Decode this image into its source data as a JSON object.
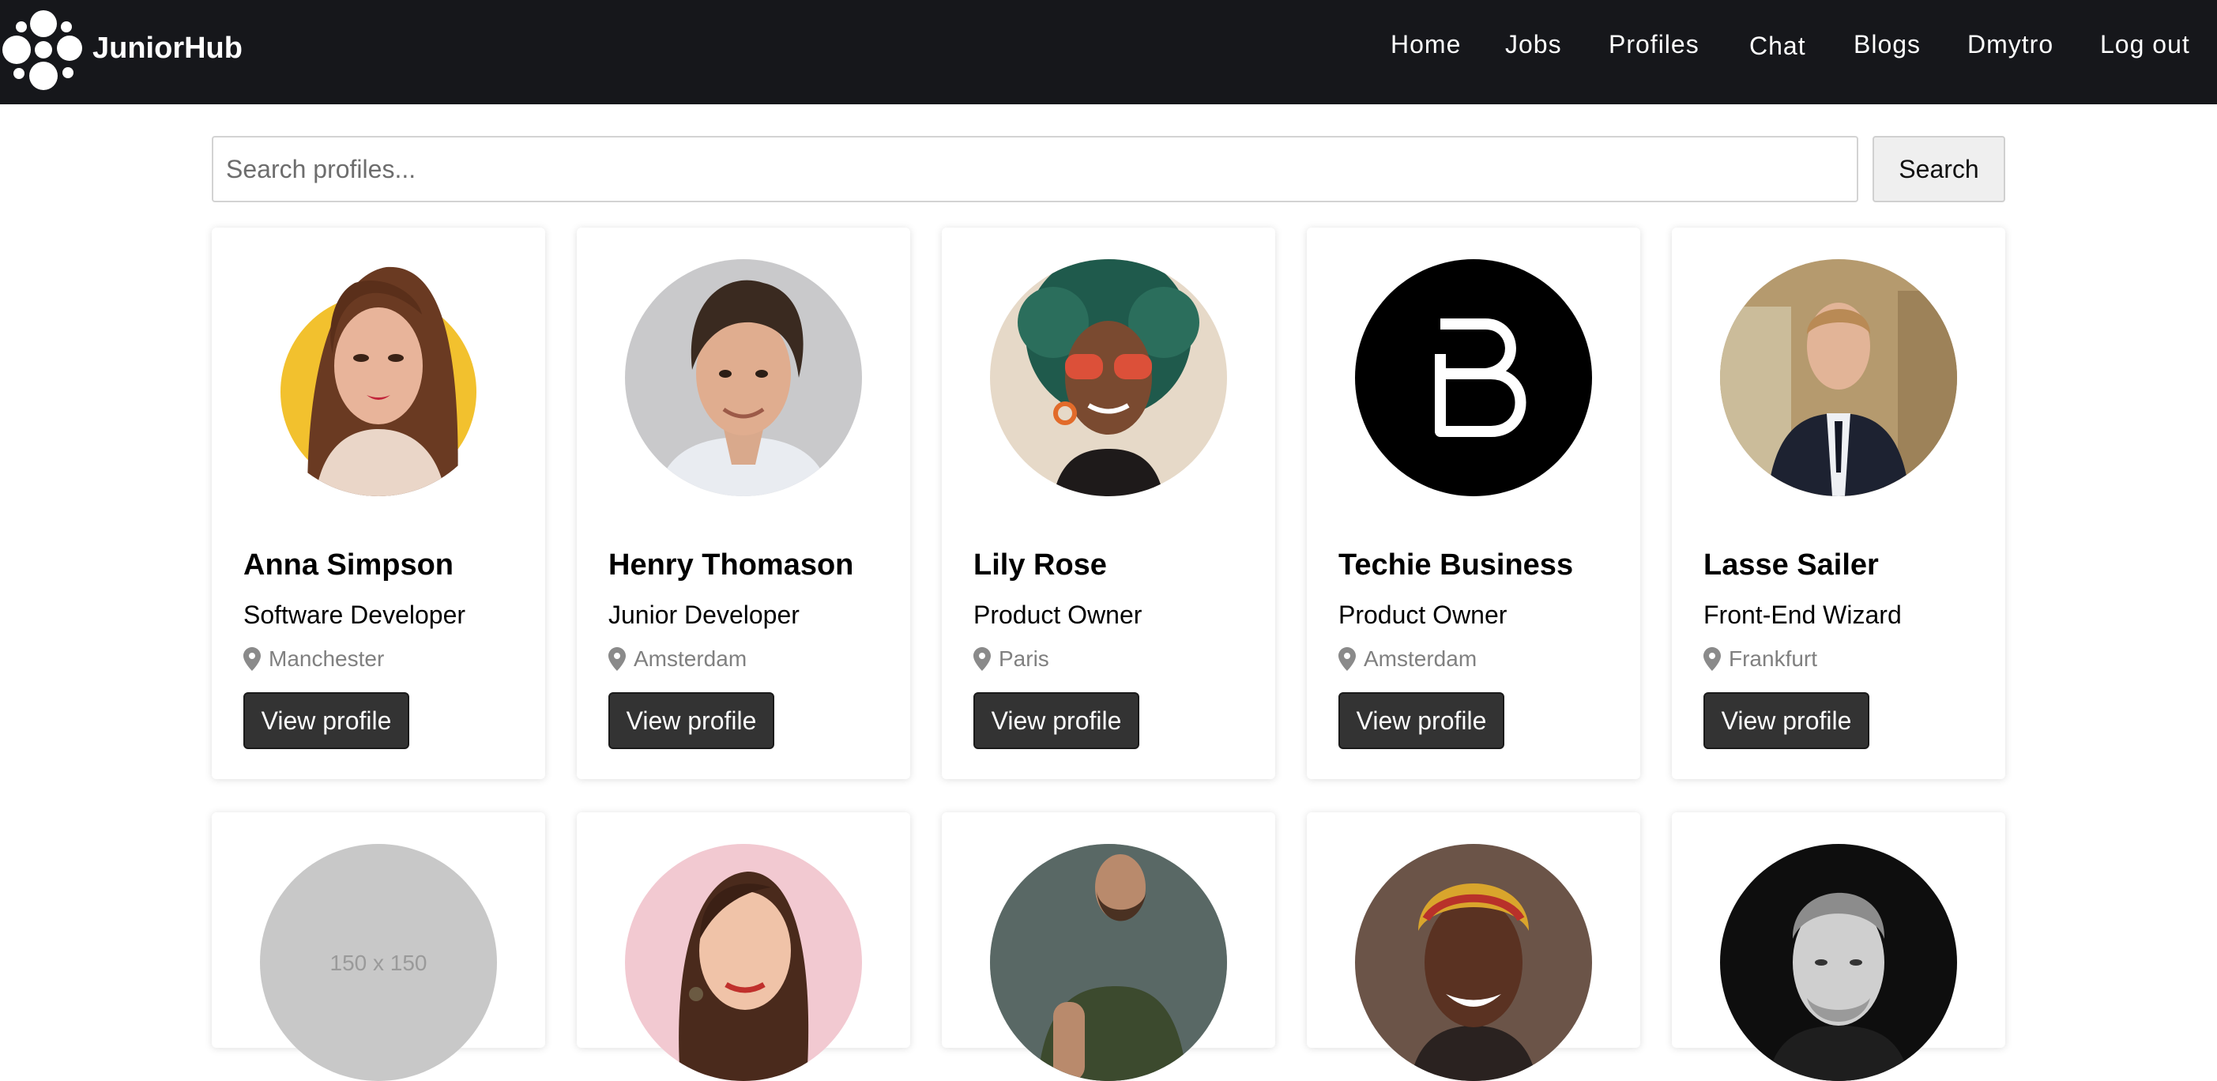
{
  "navbar": {
    "brand": "JuniorHub",
    "links": [
      "Home",
      "Jobs",
      "Profiles",
      "Chat",
      "Blogs",
      "Dmytro",
      "Log out"
    ]
  },
  "search": {
    "placeholder": "Search profiles...",
    "value": "",
    "button_label": "Search"
  },
  "view_profile_label": "View profile",
  "profiles": [
    {
      "name": "Anna Simpson",
      "role": "Software Developer",
      "location": "Manchester",
      "avatar": "illustrated-woman-portrait"
    },
    {
      "name": "Henry Thomason",
      "role": "Junior Developer",
      "location": "Amsterdam",
      "avatar": "man-portrait"
    },
    {
      "name": "Lily Rose",
      "role": "Product Owner",
      "location": "Paris",
      "avatar": "woman-sunglasses-portrait"
    },
    {
      "name": "Techie Business",
      "role": "Product Owner",
      "location": "Amsterdam",
      "avatar": "b-letter-logo"
    },
    {
      "name": "Lasse Sailer",
      "role": "Front-End Wizard",
      "location": "Frankfurt",
      "avatar": "man-suit-portrait"
    }
  ],
  "second_row": [
    {
      "avatar": "placeholder-image",
      "placeholder_text": "150 x 150"
    },
    {
      "avatar": "woman-pink-background-portrait"
    },
    {
      "avatar": "bearded-man-portrait"
    },
    {
      "avatar": "smiling-woman-headwrap-portrait"
    },
    {
      "avatar": "man-black-and-white-portrait"
    }
  ],
  "colors": {
    "navbar_bg": "#16171b",
    "button_dark": "#333333",
    "location_text": "#808080"
  }
}
